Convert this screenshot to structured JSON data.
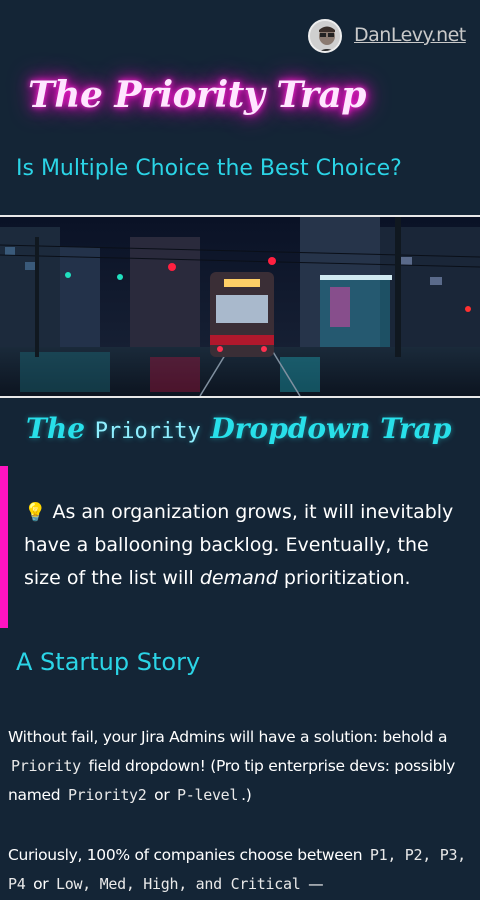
{
  "header": {
    "site_name": "DanLevy.net"
  },
  "hero": {
    "title": "The Priority Trap",
    "subtitle": "Is Multiple Choice the Best Choice?"
  },
  "section": {
    "title_part1": "The ",
    "title_code": "Priority",
    "title_part2": " Dropdown Trap"
  },
  "callout": {
    "icon": "lightbulb-icon",
    "text_before": " As an organization grows, it will inevitably have a ballooning backlog. Eventually, the size of the list will ",
    "emphasis": "demand",
    "text_after": " prioritization."
  },
  "story": {
    "heading": "A Startup Story",
    "p1_a": "Without fail, your Jira Admins will have a solution: behold a ",
    "p1_code1": "Priority",
    "p1_b": " field dropdown! (Pro tip enterprise devs: possibly named ",
    "p1_code2": "Priority2",
    "p1_c": " or ",
    "p1_code3": "P-level",
    "p1_d": ".)",
    "p2_a": "Curiously, 100% of companies choose between ",
    "p2_code": "P1, P2, P3, P4",
    "p2_b": " or ",
    "p2_code2": "Low, Med, High, and Critical",
    "p2_c": " —"
  },
  "colors": {
    "background": "#142536",
    "accent_cyan": "#2bd4e6",
    "accent_magenta": "#ff14c0"
  }
}
